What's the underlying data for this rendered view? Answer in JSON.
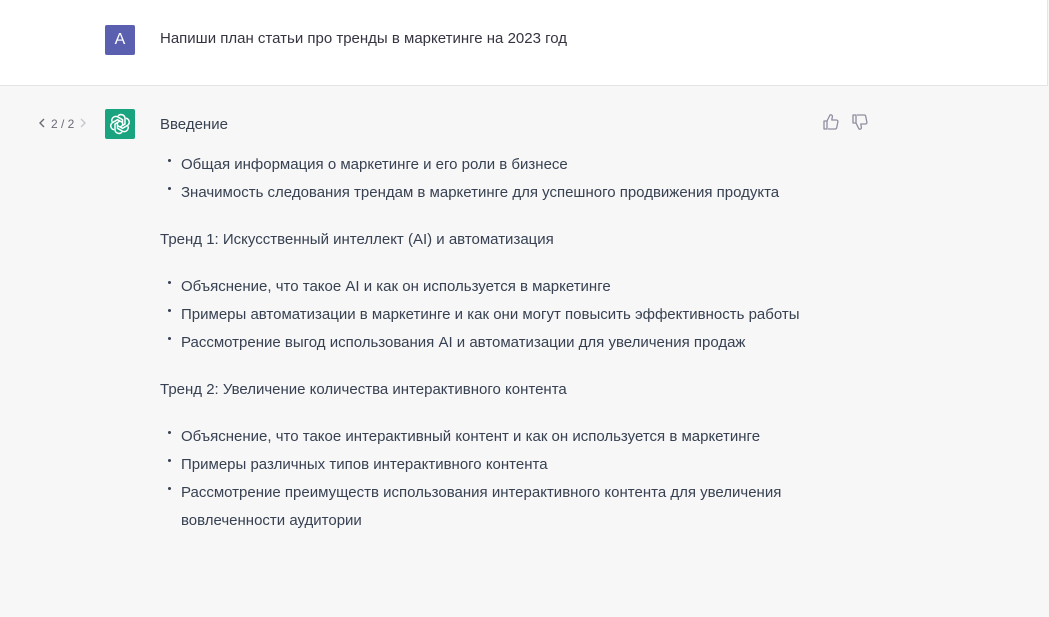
{
  "user": {
    "avatar_letter": "A",
    "message": "Напиши план статьи про тренды в маркетинге на 2023 год"
  },
  "assistant": {
    "pager": "2 / 2",
    "sections": [
      {
        "heading": "Введение",
        "bullets": [
          "Общая информация о маркетинге и его роли в бизнесе",
          "Значимость следования трендам в маркетинге для успешного продвижения продукта"
        ]
      },
      {
        "heading": "Тренд 1: Искусственный интеллект (AI) и автоматизация",
        "bullets": [
          "Объяснение, что такое AI и как он используется в маркетинге",
          "Примеры автоматизации в маркетинге и как они могут повысить эффективность работы",
          "Рассмотрение выгод использования AI и автоматизации для увеличения продаж"
        ]
      },
      {
        "heading": "Тренд 2: Увеличение количества интерактивного контента",
        "bullets": [
          "Объяснение, что такое интерактивный контент и как он используется в маркетинге",
          "Примеры различных типов интерактивного контента",
          "Рассмотрение преимуществ использования интерактивного контента для увеличения вовлеченности аудитории"
        ]
      }
    ]
  },
  "icons": {
    "prev": "chevron-left-icon",
    "next": "chevron-right-icon",
    "bot": "openai-logo-icon",
    "like": "thumbs-up-icon",
    "dislike": "thumbs-down-icon"
  },
  "colors": {
    "user_avatar": "#5a5fb0",
    "bot_avatar": "#19a37f",
    "assistant_bg": "#f7f7f8",
    "user_bg": "#ffffff"
  }
}
